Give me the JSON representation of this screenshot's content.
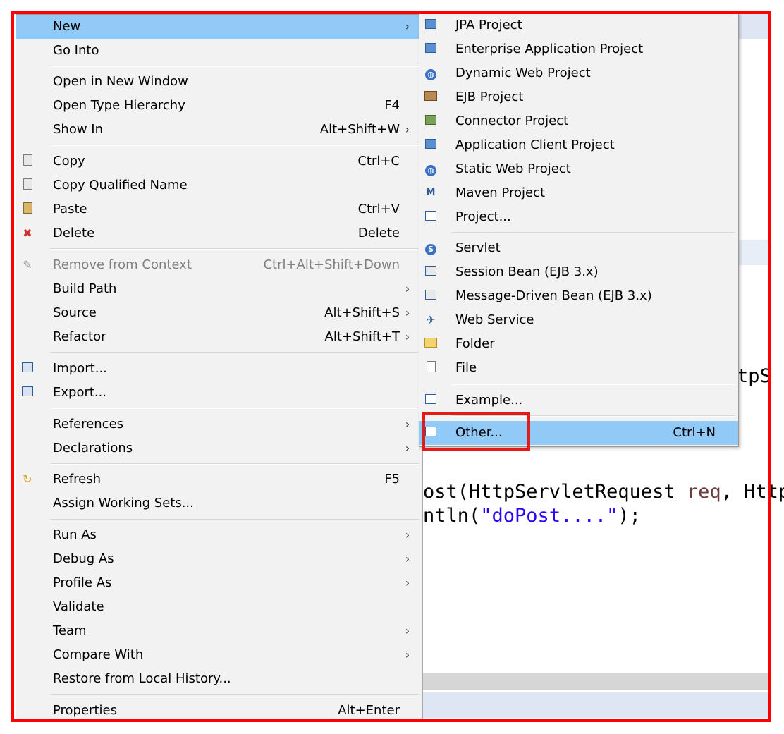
{
  "editor": {
    "code_tail_top": "tpS",
    "line1_a": "ost(HttpServletRequest ",
    "line1_param": "req",
    "line1_b": ", Http",
    "line2_a": "ntln(",
    "line2_str": "\"doPost....\"",
    "line2_b": ");"
  },
  "main_menu": {
    "new": {
      "label": "New"
    },
    "go_into": {
      "label": "Go Into"
    },
    "open_new_window": {
      "label": "Open in New Window"
    },
    "open_type_hierarchy": {
      "label": "Open Type Hierarchy",
      "shortcut": "F4"
    },
    "show_in": {
      "label": "Show In",
      "shortcut": "Alt+Shift+W"
    },
    "copy": {
      "label": "Copy",
      "shortcut": "Ctrl+C"
    },
    "copy_qualified": {
      "label": "Copy Qualified Name"
    },
    "paste": {
      "label": "Paste",
      "shortcut": "Ctrl+V"
    },
    "delete": {
      "label": "Delete",
      "shortcut": "Delete"
    },
    "remove_context": {
      "label": "Remove from Context",
      "shortcut": "Ctrl+Alt+Shift+Down"
    },
    "build_path": {
      "label": "Build Path"
    },
    "source": {
      "label": "Source",
      "shortcut": "Alt+Shift+S"
    },
    "refactor": {
      "label": "Refactor",
      "shortcut": "Alt+Shift+T"
    },
    "import": {
      "label": "Import..."
    },
    "export": {
      "label": "Export..."
    },
    "references": {
      "label": "References"
    },
    "declarations": {
      "label": "Declarations"
    },
    "refresh": {
      "label": "Refresh",
      "shortcut": "F5"
    },
    "assign_working_sets": {
      "label": "Assign Working Sets..."
    },
    "run_as": {
      "label": "Run As"
    },
    "debug_as": {
      "label": "Debug As"
    },
    "profile_as": {
      "label": "Profile As"
    },
    "validate": {
      "label": "Validate"
    },
    "team": {
      "label": "Team"
    },
    "compare_with": {
      "label": "Compare With"
    },
    "restore_history": {
      "label": "Restore from Local History..."
    },
    "properties": {
      "label": "Properties",
      "shortcut": "Alt+Enter"
    }
  },
  "sub_menu": {
    "jpa": {
      "label": "JPA Project"
    },
    "enterprise": {
      "label": "Enterprise Application Project"
    },
    "dynamic_web": {
      "label": "Dynamic Web Project"
    },
    "ejb": {
      "label": "EJB Project"
    },
    "connector": {
      "label": "Connector Project"
    },
    "app_client": {
      "label": "Application Client Project"
    },
    "static_web": {
      "label": "Static Web Project"
    },
    "maven": {
      "label": "Maven Project"
    },
    "project": {
      "label": "Project..."
    },
    "servlet": {
      "label": "Servlet"
    },
    "session_bean": {
      "label": "Session Bean (EJB 3.x)"
    },
    "message_bean": {
      "label": "Message-Driven Bean (EJB 3.x)"
    },
    "web_service": {
      "label": "Web Service"
    },
    "folder": {
      "label": "Folder"
    },
    "file": {
      "label": "File"
    },
    "example": {
      "label": "Example..."
    },
    "other": {
      "label": "Other...",
      "shortcut": "Ctrl+N"
    }
  },
  "colors": {
    "selection": "#91c9f7",
    "highlight_box": "#ff0000",
    "menu_bg": "#f2f2f2"
  }
}
